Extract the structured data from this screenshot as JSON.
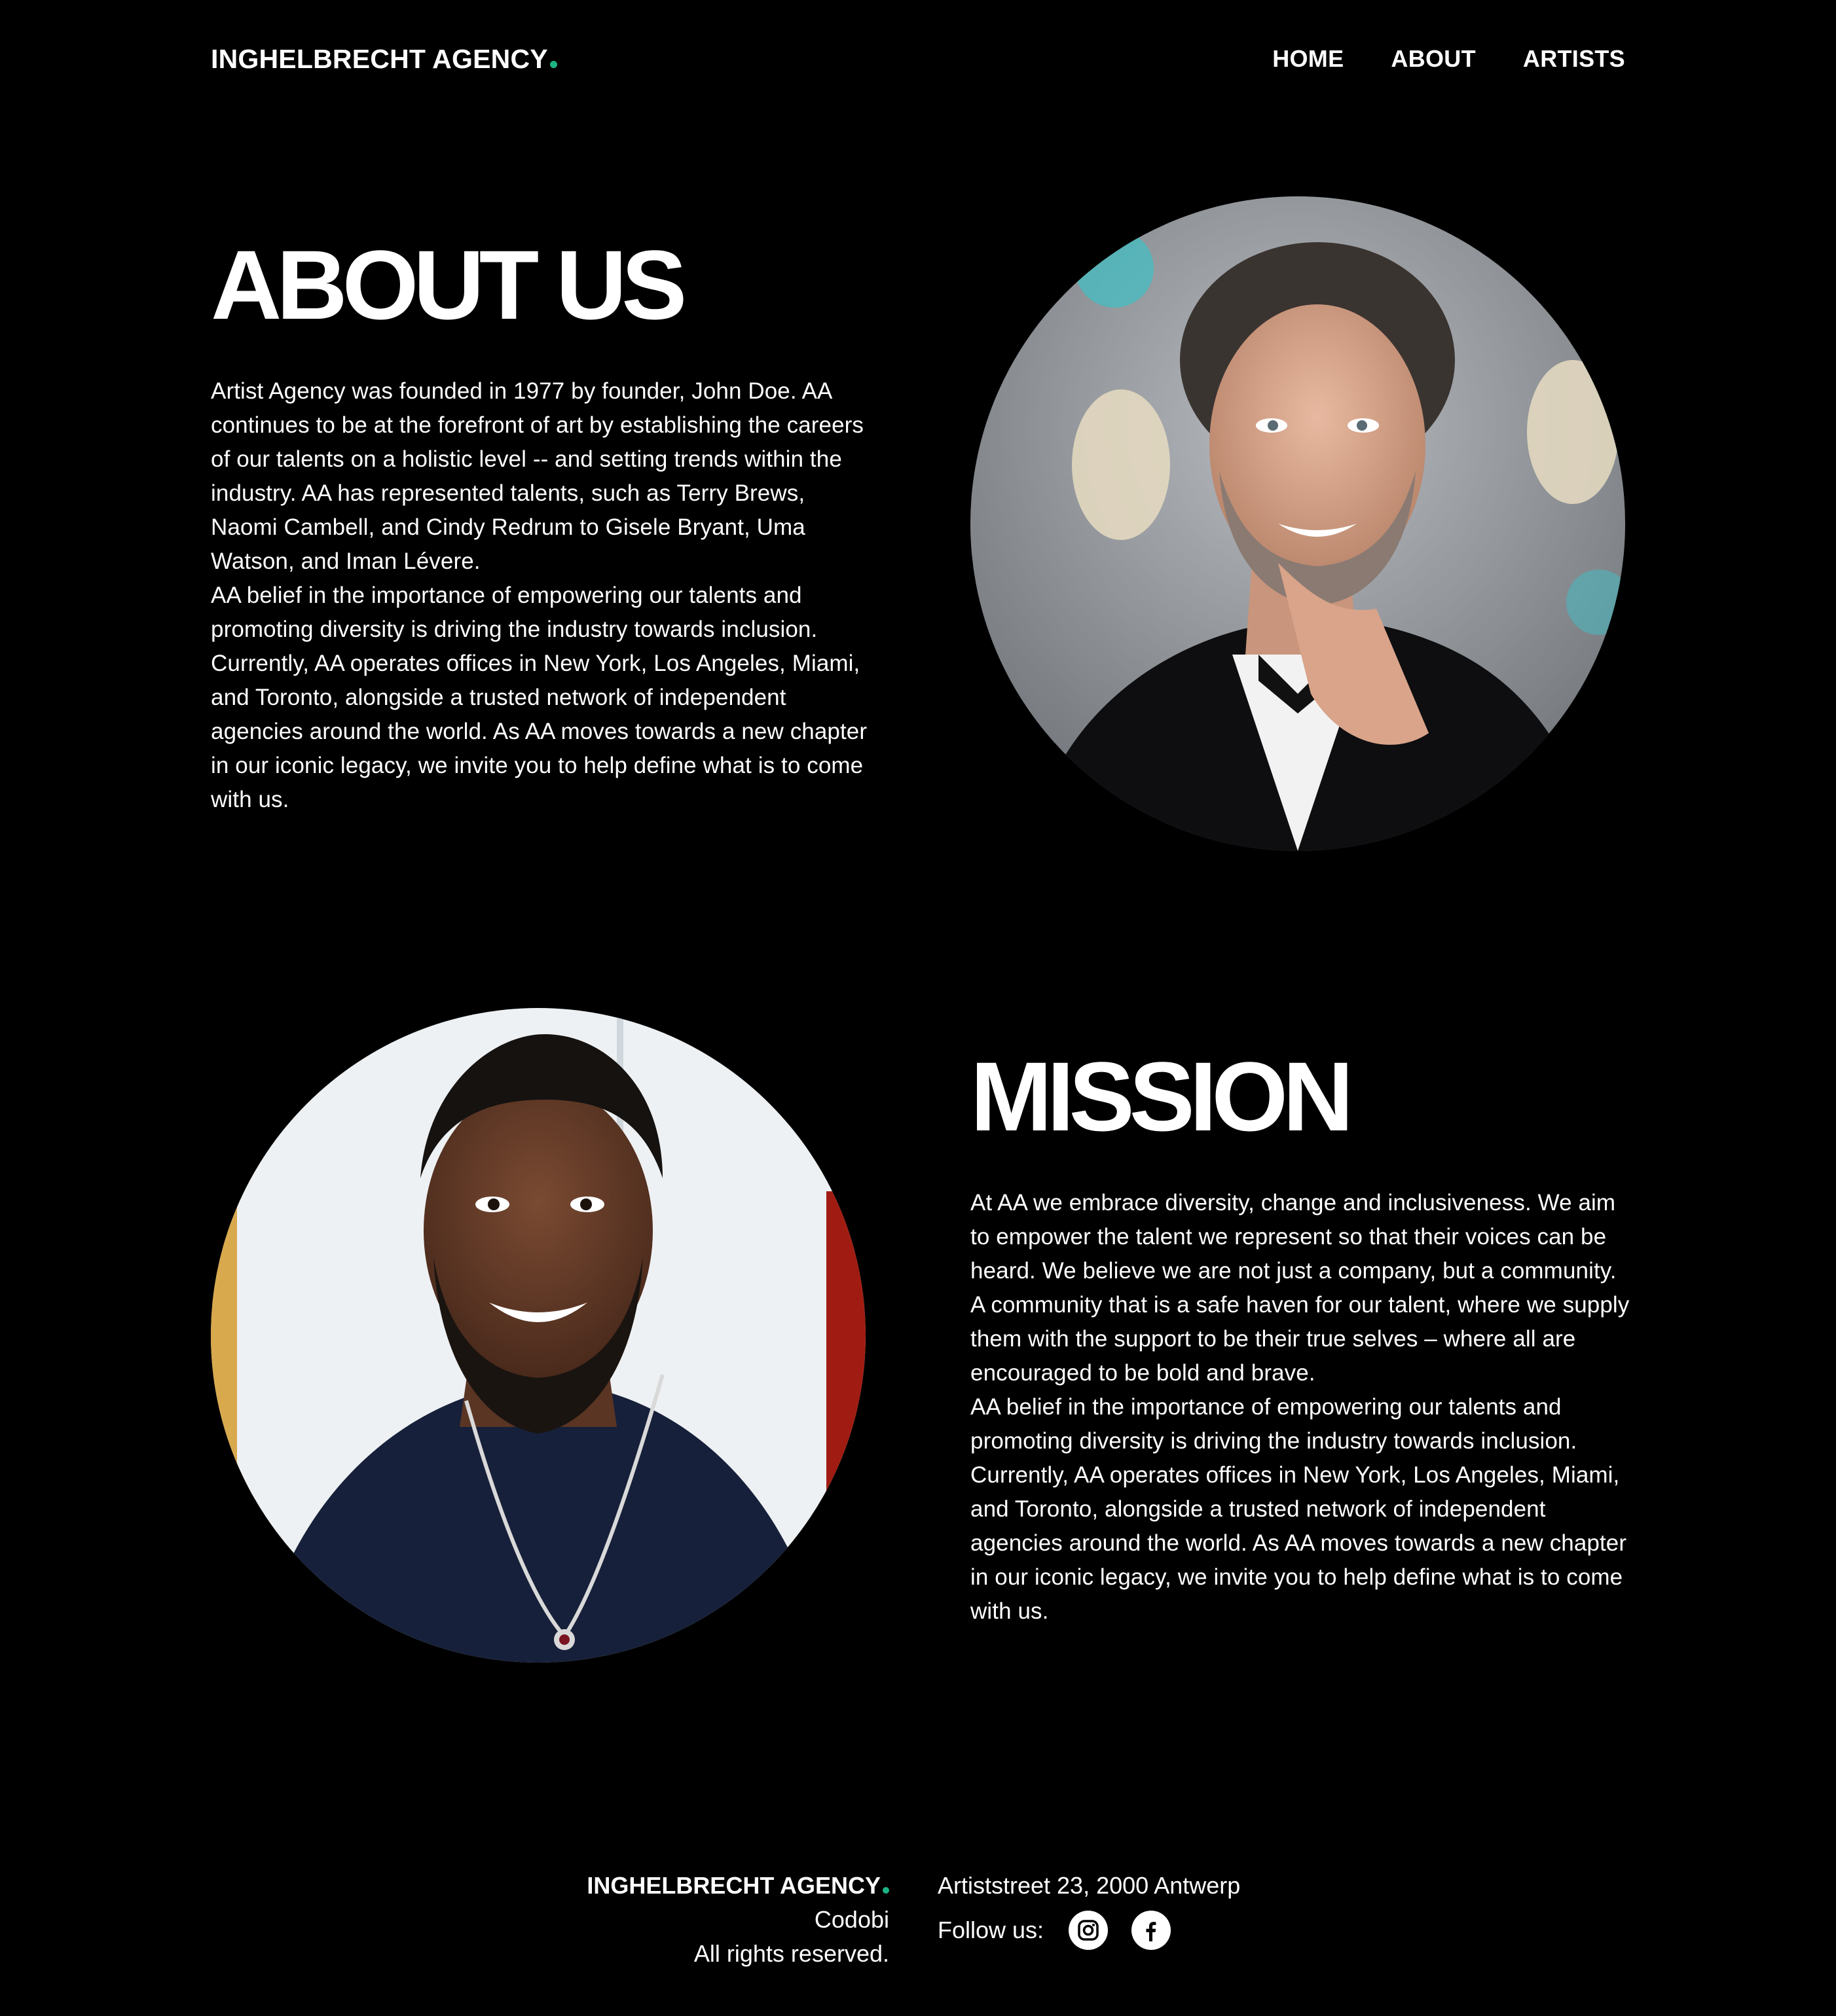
{
  "header": {
    "logo": "INGHELBRECHT AGENCY",
    "nav": [
      "HOME",
      "ABOUT",
      "ARTISTS"
    ]
  },
  "about": {
    "title": "ABOUT US",
    "paragraphs": [
      "Artist Agency was founded in 1977 by founder, John Doe. AA continues to be at the forefront of art by establishing the careers of our talents on a holistic level -- and setting trends within the industry. AA has represented talents, such as Terry Brews, Naomi Cambell, and Cindy Redrum to Gisele Bryant, Uma Watson, and Iman Lévere.",
      "AA belief in the importance of empowering our talents and promoting diversity is driving the industry towards inclusion. Currently, AA operates offices in New York, Los Angeles, Miami, and Toronto, alongside a trusted network of independent agencies around the world. As AA moves towards a new chapter in our iconic legacy, we invite you to help define what is to come with us."
    ]
  },
  "mission": {
    "title": "MISSION",
    "paragraphs": [
      "At AA we embrace diversity, change and inclusiveness. We aim to empower the talent we represent so that their voices can be heard. We believe we are not just a company, but a community. A community that is a safe haven for our talent, where we supply them with the support to be their true selves – where all are encouraged to be bold and brave.",
      "AA belief in the importance of empowering our talents and promoting diversity is driving the industry towards inclusion. Currently, AA operates offices in New York, Los Angeles, Miami, and Toronto, alongside a trusted network of independent agencies around the world. As AA moves towards a new chapter in our iconic legacy, we invite you to help define what is to come with us."
    ]
  },
  "footer": {
    "brand": "INGHELBRECHT AGENCY",
    "line2": "Codobi",
    "line3": "All rights reserved.",
    "address": "Artiststreet 23, 2000 Antwerp",
    "follow_label": "Follow us:",
    "social_icons": [
      "instagram-icon",
      "facebook-icon"
    ]
  },
  "colors": {
    "background": "#000000",
    "text": "#ffffff",
    "accent": "#1db485"
  }
}
